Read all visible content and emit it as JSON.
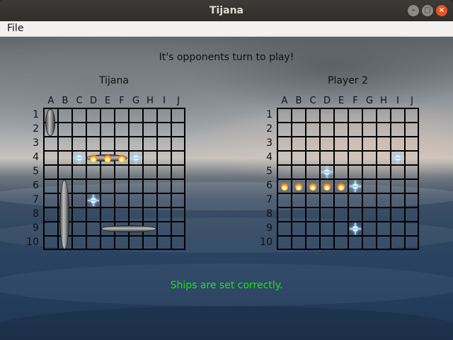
{
  "window": {
    "title": "Tijana"
  },
  "menu": {
    "file_label": "File"
  },
  "status_text": "It's opponents turn to play!",
  "left_board": {
    "name": "Tijana"
  },
  "right_board": {
    "name": "Player 2"
  },
  "columns": [
    "A",
    "B",
    "C",
    "D",
    "E",
    "F",
    "G",
    "H",
    "I",
    "J"
  ],
  "rows": [
    "1",
    "2",
    "3",
    "4",
    "5",
    "6",
    "7",
    "8",
    "9",
    "10"
  ],
  "message": "Ships are set correctly.",
  "colors": {
    "message": "#19e619",
    "grid": "#000000"
  },
  "icons": {
    "hit": "fire-icon",
    "miss": "splash-icon"
  }
}
